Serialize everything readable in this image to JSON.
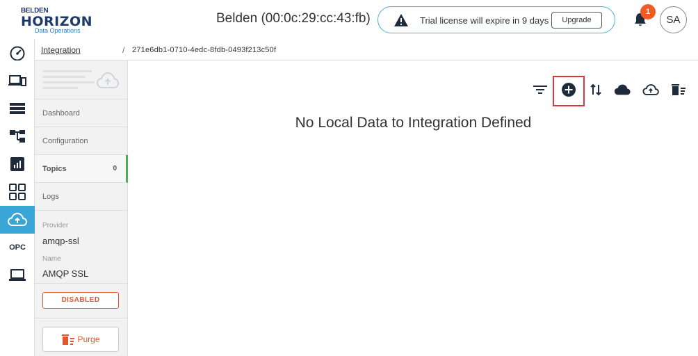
{
  "header": {
    "logo_line1": "BELDEN",
    "logo_line2": "HORIZON",
    "logo_tm": "™",
    "logo_sub": "Data Operations",
    "device_title": "Belden (00:0c:29:cc:43:fb)",
    "license_message": "Trial license will expire in 9 days",
    "upgrade_label": "Upgrade",
    "notification_count": "1",
    "avatar_initials": "SA"
  },
  "left_nav": {
    "items": [
      {
        "icon": "dashboard-gauge-icon"
      },
      {
        "icon": "devices-icon"
      },
      {
        "icon": "list-icon"
      },
      {
        "icon": "hierarchy-icon"
      },
      {
        "icon": "report-chart-icon"
      },
      {
        "icon": "apps-grid-icon"
      },
      {
        "icon": "cloud-upload-icon",
        "active": true
      },
      {
        "label": "OPC"
      },
      {
        "icon": "laptop-icon"
      }
    ],
    "active_color": "#3aa6d8"
  },
  "breadcrumb": {
    "link": "Integration",
    "separator": "/",
    "current": "271e6db1-0710-4edc-8fdb-0493f213c50f"
  },
  "side_panel": {
    "menu": [
      {
        "label": "Dashboard"
      },
      {
        "label": "Configuration"
      },
      {
        "label": "Topics",
        "count": "0",
        "active": true
      },
      {
        "label": "Logs"
      }
    ],
    "provider_label": "Provider",
    "provider_value": "amqp-ssl",
    "name_label": "Name",
    "name_value": "AMQP SSL",
    "status_label": "DISABLED",
    "purge_label": "Purge"
  },
  "main": {
    "empty_message": "No Local Data to Integration Defined",
    "toolbar": [
      "filter-icon",
      "add-circle-icon",
      "sort-arrows-icon",
      "cloud-filled-icon",
      "cloud-outline-icon",
      "delete-list-icon"
    ]
  },
  "colors": {
    "accent": "#3aa6d8",
    "danger": "#e4572e",
    "highlight": "#d9383a",
    "success": "#4caf50"
  }
}
